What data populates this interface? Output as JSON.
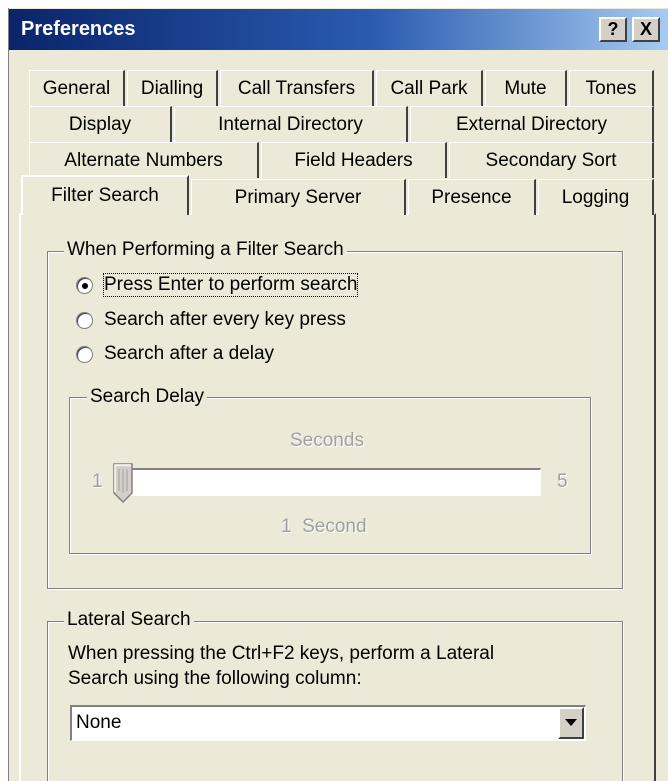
{
  "window": {
    "title": "Preferences",
    "help_button": "?",
    "close_button": "X"
  },
  "tabs": {
    "row1": [
      "General",
      "Dialling",
      "Call Transfers",
      "Call Park",
      "Mute",
      "Tones"
    ],
    "row2": [
      "Display",
      "Internal Directory",
      "External Directory"
    ],
    "row3": [
      "Alternate Numbers",
      "Field Headers",
      "Secondary Sort"
    ],
    "row4": [
      "Filter Search",
      "Primary Server",
      "Presence",
      "Logging"
    ],
    "active": "Filter Search"
  },
  "filter_search": {
    "group_label": "When Performing a Filter Search",
    "options": [
      {
        "label": "Press Enter to perform search",
        "selected": true
      },
      {
        "label": "Search after every key press",
        "selected": false
      },
      {
        "label": "Search after a delay",
        "selected": false
      }
    ]
  },
  "search_delay": {
    "group_label": "Search Delay",
    "unit_label": "Seconds",
    "min": "1",
    "max": "5",
    "value": 1,
    "value_label": "1  Second",
    "enabled": false
  },
  "lateral_search": {
    "group_label": "Lateral Search",
    "description_line1": "When pressing the Ctrl+F2 keys, perform a Lateral",
    "description_line2": "Search using the following column:",
    "selected_column": "None"
  },
  "icons": {
    "dropdown": "chevron-down-icon",
    "slider_thumb": "slider-thumb-icon"
  }
}
